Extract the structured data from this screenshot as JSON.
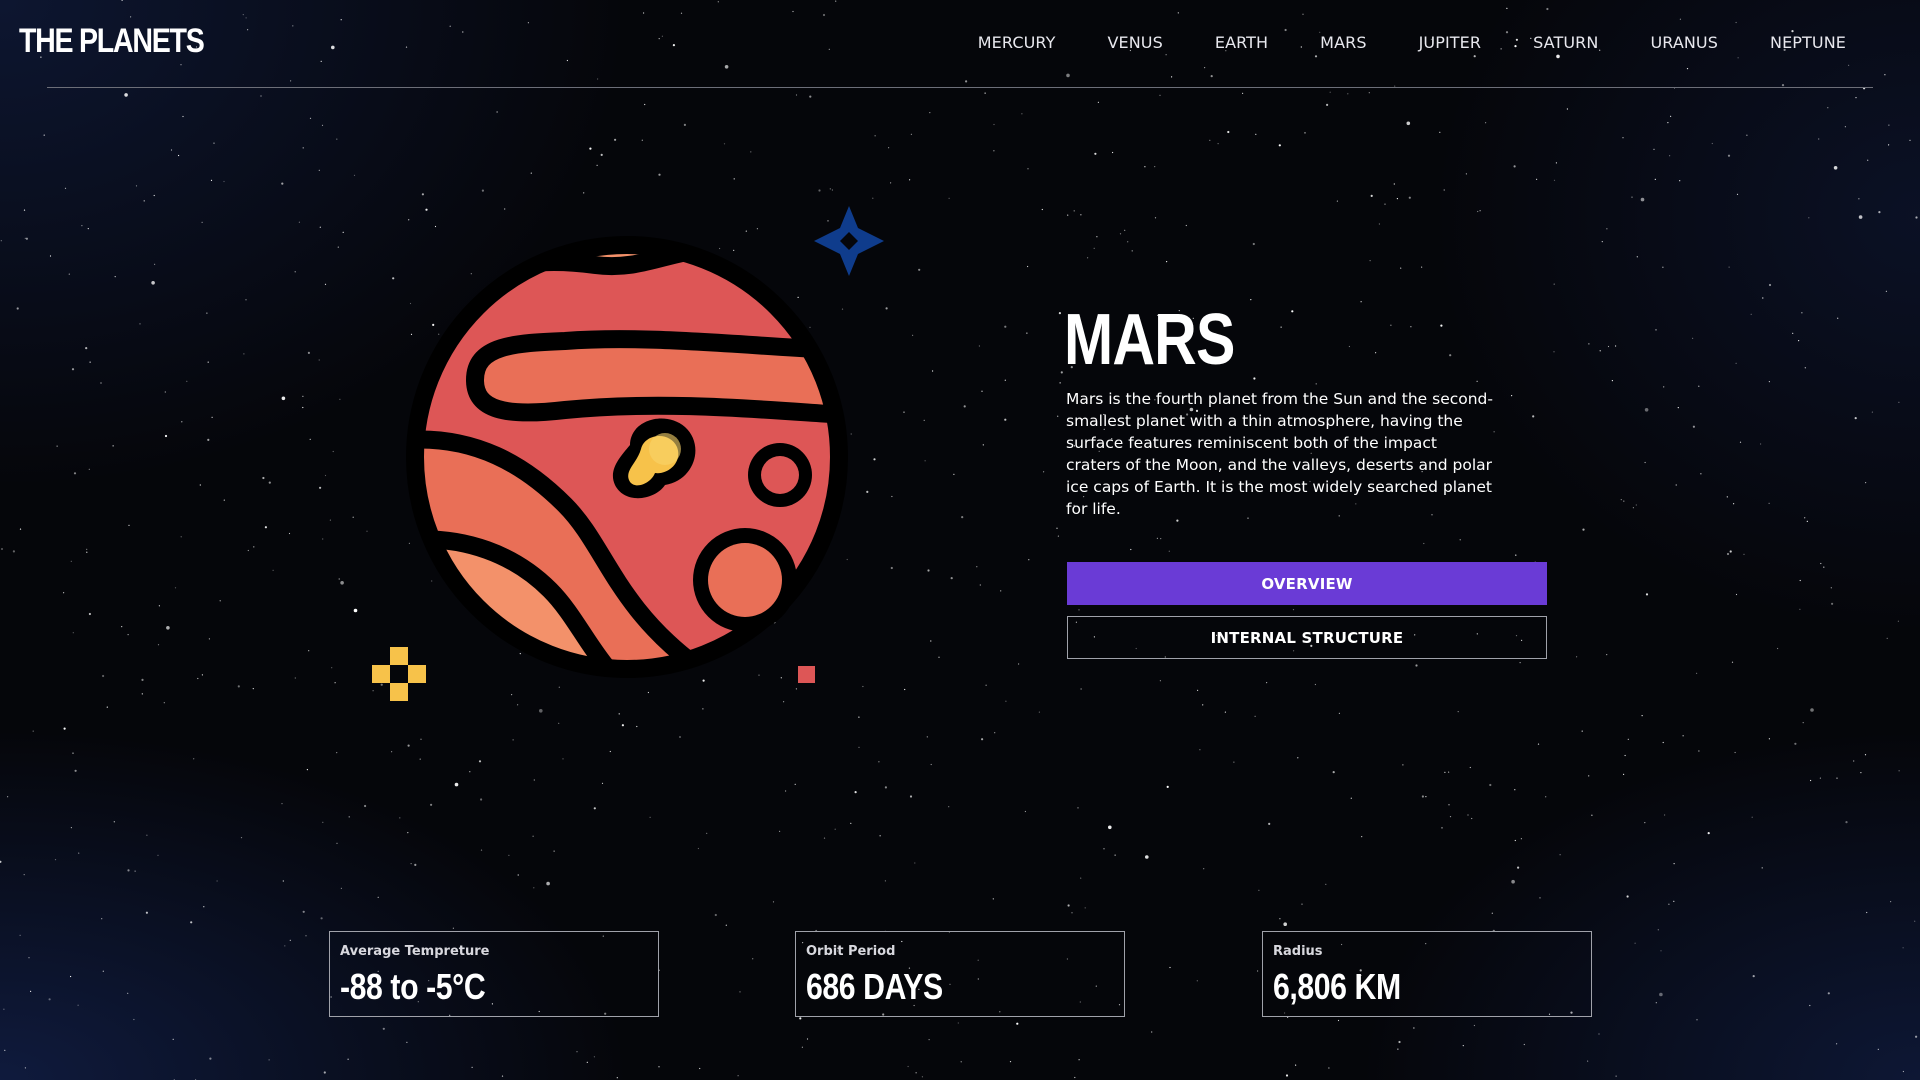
{
  "header": {
    "logo": "THE PLANETS",
    "nav": [
      "MERCURY",
      "VENUS",
      "EARTH",
      "MARS",
      "JUPITER",
      "SATURN",
      "URANUS",
      "NEPTUNE"
    ]
  },
  "planet": {
    "name": "MARS",
    "description": "Mars is the fourth planet from the Sun and the second-smallest planet with a thin atmosphere, having the surface features reminiscent both of the impact craters of the Moon, and the valleys, deserts and polar ice caps of Earth. It is the most widely searched planet for life.",
    "icon": "mars-planet-icon",
    "colors": {
      "body": "#dd5656",
      "band_light": "#f3916a",
      "band_mid": "#e96f57",
      "highlight": "#f7c24a",
      "sparkle_blue": "#0f3c8c",
      "sparkle_yellow": "#f7c24a",
      "square_red": "#dd5656"
    }
  },
  "tabs": {
    "overview": "OVERVIEW",
    "structure": "INTERNAL STRUCTURE",
    "active_color": "#6a3bd6"
  },
  "stats": [
    {
      "label": "Average Tempreture",
      "value": "-88 to -5°C"
    },
    {
      "label": "Orbit Period",
      "value": "686 DAYS"
    },
    {
      "label": "Radius",
      "value": "6,806 KM"
    }
  ]
}
